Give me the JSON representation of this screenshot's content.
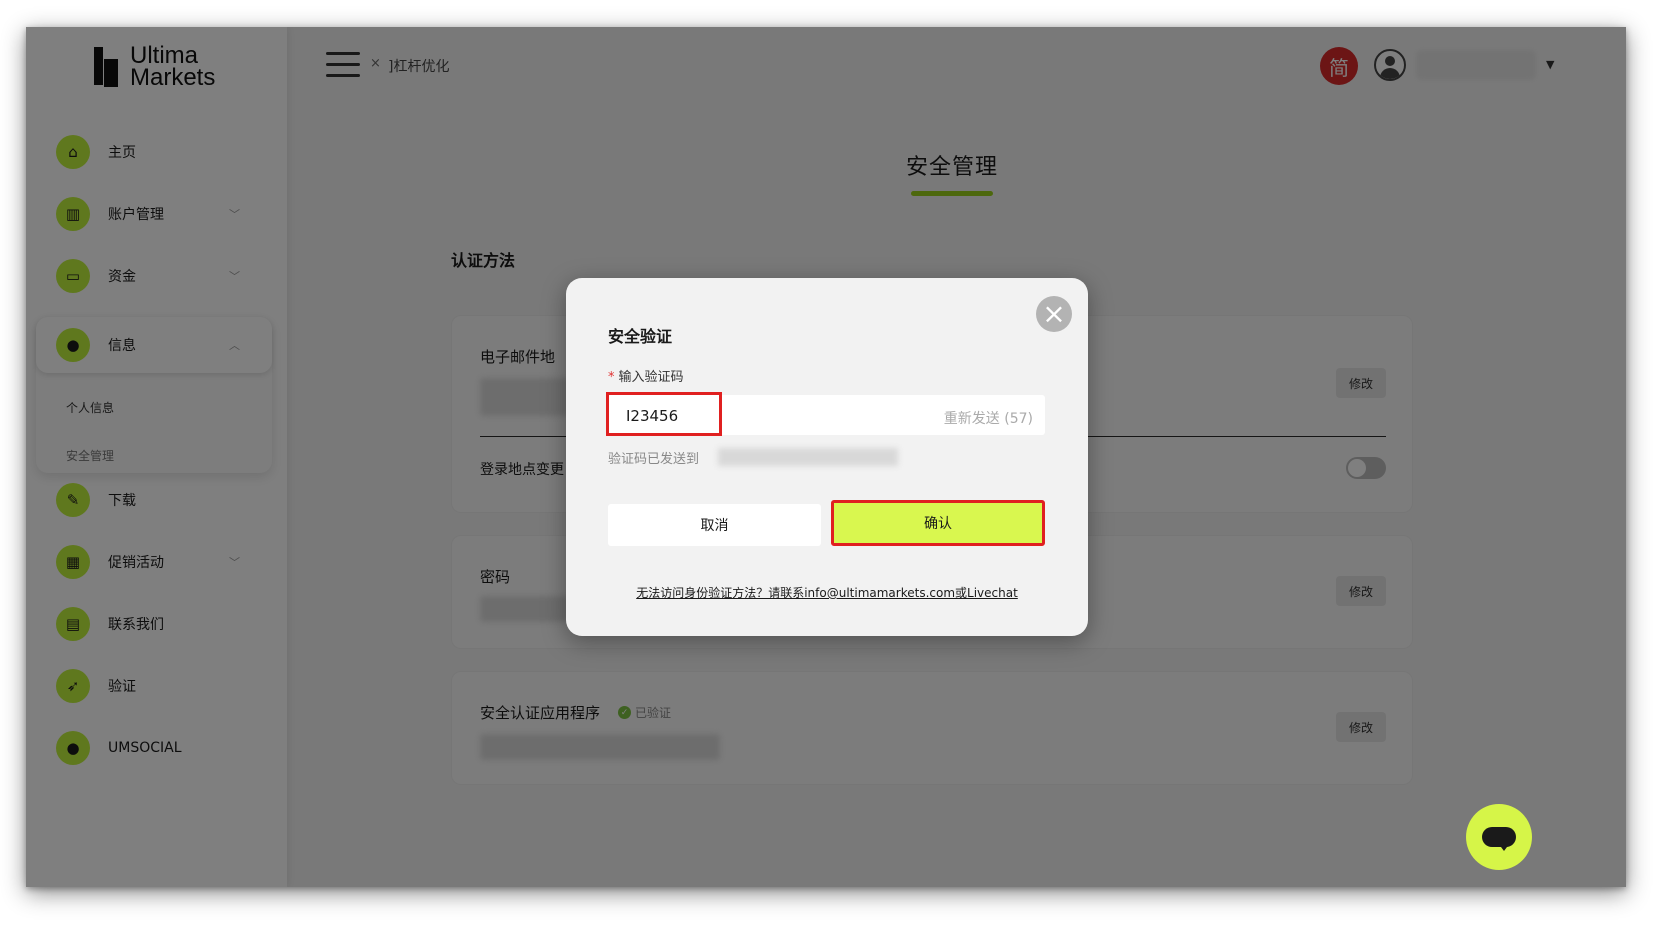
{
  "brand": {
    "line1": "Ultima",
    "line2": "Markets"
  },
  "sidebar": {
    "items": [
      {
        "label": "主页",
        "icon": "home-icon",
        "glyph": "⌂"
      },
      {
        "label": "账户管理",
        "icon": "bar-chart-icon",
        "glyph": "▥"
      },
      {
        "label": "资金",
        "icon": "wallet-icon",
        "glyph": "▭"
      },
      {
        "label": "信息",
        "icon": "user-icon",
        "glyph": "●"
      },
      {
        "label": "下载",
        "icon": "wrench-icon",
        "glyph": "✎"
      },
      {
        "label": "促销活动",
        "icon": "gift-icon",
        "glyph": "▦"
      },
      {
        "label": "联系我们",
        "icon": "message-icon",
        "glyph": "▤"
      },
      {
        "label": "验证",
        "icon": "rocket-icon",
        "glyph": "➶"
      },
      {
        "label": "UMSOCIAL",
        "icon": "user-icon",
        "glyph": "●"
      }
    ],
    "submenu": [
      "个人信息",
      "安全管理"
    ]
  },
  "topbar": {
    "close_glyph": "×",
    "tab_label": "]杠杆优化",
    "language_glyph": "简"
  },
  "main": {
    "page_title": "安全管理",
    "section_label": "认证方法",
    "cards": {
      "email_title": "电子邮件地",
      "login_location": "登录地点变更",
      "password_title": "密码",
      "authenticator_title": "安全认证应用程序",
      "verified_label": "已验证",
      "edit_label": "修改"
    }
  },
  "modal": {
    "title": "安全验证",
    "field_label": "输入验证码",
    "required_mark": "*",
    "code_value": "I23456",
    "resend": "重新发送 (57)",
    "sent_hint": "验证码已发送到",
    "cancel_label": "取消",
    "confirm_label": "确认",
    "help_text": "无法访问身份验证方法？请联系info@ultimamarkets.com或Livechat",
    "close_glyph": "×"
  }
}
